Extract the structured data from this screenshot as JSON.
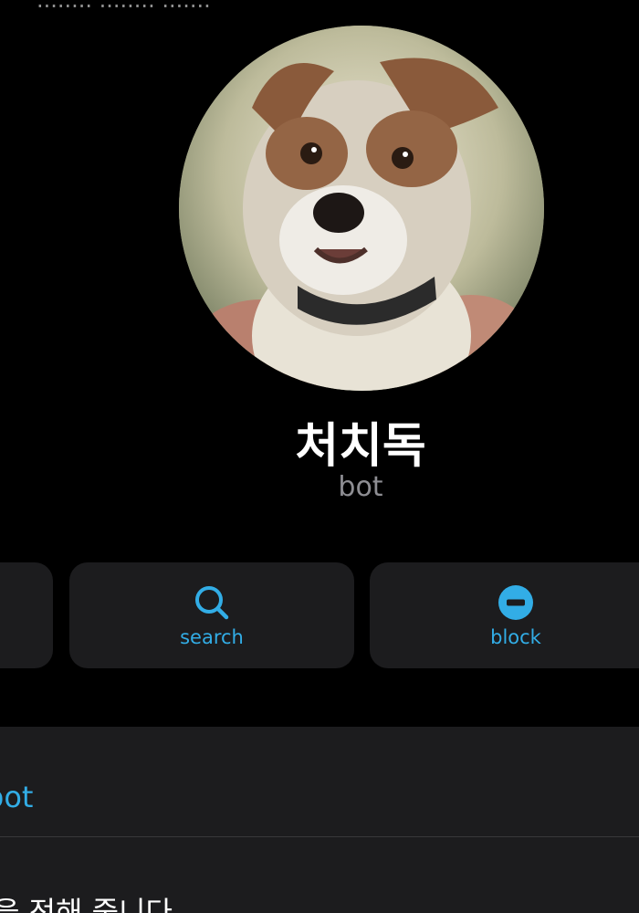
{
  "header": {
    "top_cut_text": "........ ........ ......."
  },
  "profile": {
    "name": "처치독",
    "subtitle": "bot"
  },
  "actions": {
    "search_label": "search",
    "block_label": "block"
  },
  "info": {
    "username_text": "bot",
    "description_text": "을 전해 줍니다"
  },
  "colors": {
    "accent": "#32ade6",
    "background": "#000000",
    "card": "#1c1c1e",
    "secondary_text": "#8e8e93"
  },
  "icons": {
    "search": "search-icon",
    "block": "block-icon"
  }
}
